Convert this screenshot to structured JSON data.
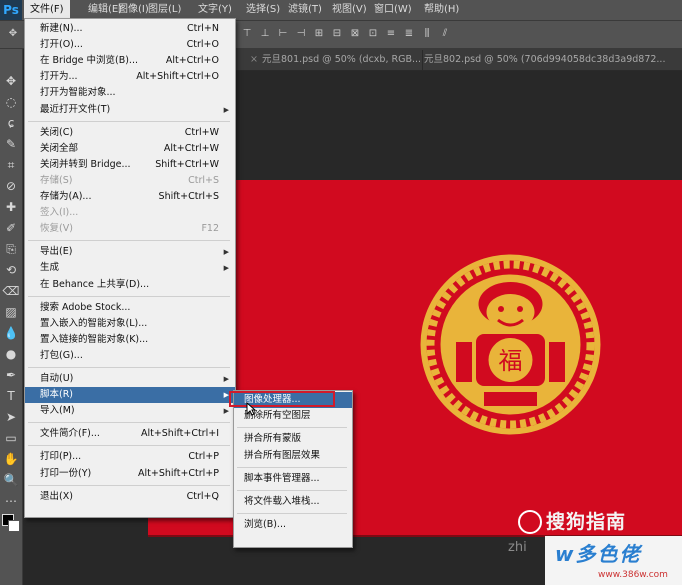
{
  "app": {
    "logo": "Ps"
  },
  "menubar": [
    {
      "label": "文件(F)",
      "active": true
    },
    {
      "label": "编辑(E)"
    },
    {
      "label": "图像(I)"
    },
    {
      "label": "图层(L)"
    },
    {
      "label": "文字(Y)"
    },
    {
      "label": "选择(S)"
    },
    {
      "label": "滤镜(T)"
    },
    {
      "label": "视图(V)"
    },
    {
      "label": "窗口(W)"
    },
    {
      "label": "帮助(H)"
    }
  ],
  "tabs": [
    {
      "label": "元旦801.psd @ 50% (dcxb, RGB...",
      "close": "×"
    },
    {
      "label": "元旦802.psd @ 50% (706d994058dc38d3a9d872...",
      "close": ""
    }
  ],
  "file_menu": [
    {
      "label": "新建(N)...",
      "shortcut": "Ctrl+N"
    },
    {
      "label": "打开(O)...",
      "shortcut": "Ctrl+O"
    },
    {
      "label": "在 Bridge 中浏览(B)...",
      "shortcut": "Alt+Ctrl+O"
    },
    {
      "label": "打开为...",
      "shortcut": "Alt+Shift+Ctrl+O"
    },
    {
      "label": "打开为智能对象..."
    },
    {
      "label": "最近打开文件(T)",
      "submenu": true
    },
    {
      "sep": true
    },
    {
      "label": "关闭(C)",
      "shortcut": "Ctrl+W"
    },
    {
      "label": "关闭全部",
      "shortcut": "Alt+Ctrl+W"
    },
    {
      "label": "关闭并转到 Bridge...",
      "shortcut": "Shift+Ctrl+W"
    },
    {
      "label": "存储(S)",
      "shortcut": "Ctrl+S",
      "disabled": true
    },
    {
      "label": "存储为(A)...",
      "shortcut": "Shift+Ctrl+S"
    },
    {
      "label": "签入(I)...",
      "disabled": true
    },
    {
      "label": "恢复(V)",
      "shortcut": "F12",
      "disabled": true
    },
    {
      "sep": true
    },
    {
      "label": "导出(E)",
      "submenu": true
    },
    {
      "label": "生成",
      "submenu": true
    },
    {
      "label": "在 Behance 上共享(D)..."
    },
    {
      "sep": true
    },
    {
      "label": "搜索 Adobe Stock..."
    },
    {
      "label": "置入嵌入的智能对象(L)..."
    },
    {
      "label": "置入链接的智能对象(K)..."
    },
    {
      "label": "打包(G)..."
    },
    {
      "sep": true
    },
    {
      "label": "自动(U)",
      "submenu": true
    },
    {
      "label": "脚本(R)",
      "submenu": true,
      "highlighted": true
    },
    {
      "label": "导入(M)",
      "submenu": true
    },
    {
      "sep": true
    },
    {
      "label": "文件简介(F)...",
      "shortcut": "Alt+Shift+Ctrl+I"
    },
    {
      "sep": true
    },
    {
      "label": "打印(P)...",
      "shortcut": "Ctrl+P"
    },
    {
      "label": "打印一份(Y)",
      "shortcut": "Alt+Shift+Ctrl+P"
    },
    {
      "sep": true
    },
    {
      "label": "退出(X)",
      "shortcut": "Ctrl+Q"
    }
  ],
  "script_submenu": [
    {
      "label": "图像处理器...",
      "highlighted": true
    },
    {
      "label": "删除所有空图层"
    },
    {
      "sep": true
    },
    {
      "label": "拼合所有蒙版"
    },
    {
      "label": "拼合所有图层效果"
    },
    {
      "sep": true
    },
    {
      "label": "脚本事件管理器..."
    },
    {
      "sep": true
    },
    {
      "label": "将文件载入堆栈..."
    },
    {
      "sep": true
    },
    {
      "label": "浏览(B)..."
    }
  ],
  "watermarks": {
    "sogou": "搜狗指南",
    "zhi": "zhi",
    "site": "w多色佬",
    "url": "www.386w.com"
  },
  "colors": {
    "accent": "#3a6ea5",
    "canvas": "#d10a1f",
    "highlight_box": "#d21a2a"
  }
}
